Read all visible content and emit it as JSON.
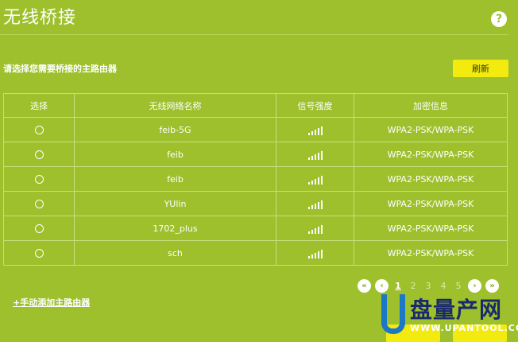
{
  "page": {
    "title": "无线桥接",
    "help_symbol": "?"
  },
  "scan": {
    "subtitle": "请选择您需要桥接的主路由器",
    "refresh_label": "刷新"
  },
  "table": {
    "headers": [
      "选择",
      "无线网络名称",
      "信号强度",
      "加密信息"
    ],
    "rows": [
      {
        "ssid": "feib-5G",
        "signal": "strong",
        "security": "WPA2-PSK/WPA-PSK"
      },
      {
        "ssid": "feib",
        "signal": "strong",
        "security": "WPA2-PSK/WPA-PSK"
      },
      {
        "ssid": "feib",
        "signal": "strong",
        "security": "WPA2-PSK/WPA-PSK"
      },
      {
        "ssid": "YUlin",
        "signal": "strong",
        "security": "WPA2-PSK/WPA-PSK"
      },
      {
        "ssid": "1702_plus",
        "signal": "strong",
        "security": "WPA2-PSK/WPA-PSK"
      },
      {
        "ssid": "sch",
        "signal": "strong",
        "security": "WPA2-PSK/WPA-PSK"
      }
    ]
  },
  "pager": {
    "first_icon": "double-chevron-left-icon",
    "prev_icon": "chevron-left-icon",
    "pages": [
      "1",
      "2",
      "3",
      "4",
      "5"
    ],
    "current": "1",
    "next_icon": "chevron-right-icon",
    "last_icon": "double-chevron-right-icon"
  },
  "add_router_link": "+手动添加主路由器",
  "watermark": {
    "brand": "盘量产网",
    "url": "WWW.UPANTOOL.COM"
  },
  "colors": {
    "background": "#9dc02c",
    "button": "#f3ea10",
    "watermark_blue": "#1d77c7"
  }
}
